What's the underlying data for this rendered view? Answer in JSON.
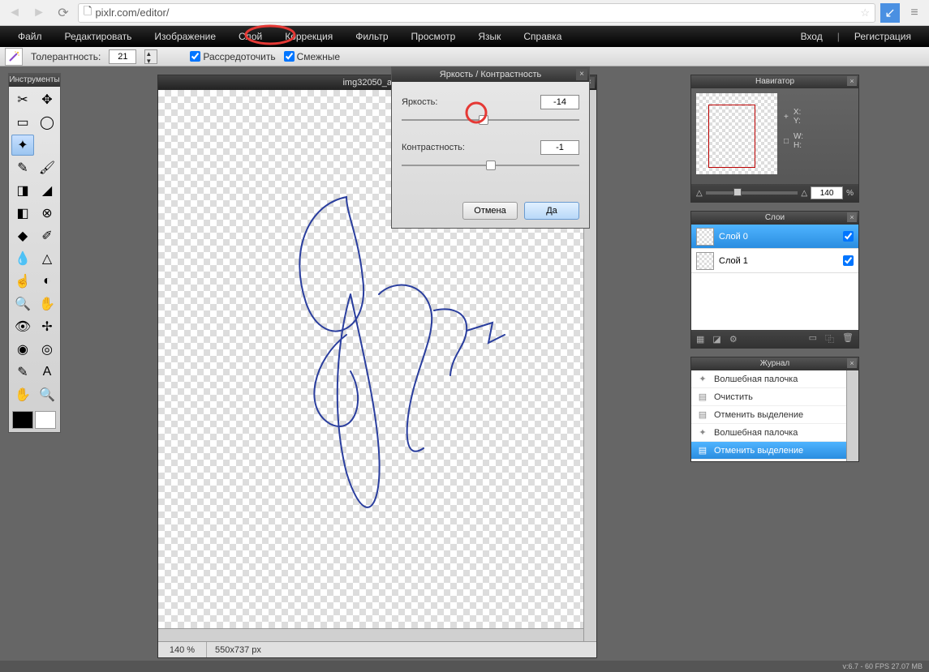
{
  "browser": {
    "url": "pixlr.com/editor/"
  },
  "menu": {
    "items": [
      "Файл",
      "Редактировать",
      "Изображение",
      "Слой",
      "Коррекция",
      "Фильтр",
      "Просмотр",
      "Язык",
      "Справка"
    ],
    "login": "Вход",
    "register": "Регистрация"
  },
  "options": {
    "tolerance_label": "Толерантность:",
    "tolerance_value": "21",
    "option1_label": "Рассредоточить",
    "option2_label": "Смежные"
  },
  "tools": {
    "title": "Инструменты"
  },
  "canvas": {
    "title": "img32050_auto...",
    "zoom": "140 %",
    "dimensions": "550x737 px"
  },
  "dialog": {
    "title": "Яркость / Контрастность",
    "brightness_label": "Яркость:",
    "brightness_value": "-14",
    "contrast_label": "Контрастность:",
    "contrast_value": "-1",
    "cancel": "Отмена",
    "ok": "Да"
  },
  "navigator": {
    "title": "Навигатор",
    "x_label": "X:",
    "y_label": "Y:",
    "w_label": "W:",
    "h_label": "H:",
    "zoom": "140",
    "zoom_pct": "%"
  },
  "layers": {
    "title": "Слои",
    "items": [
      {
        "name": "Слой 0",
        "selected": true
      },
      {
        "name": "Слой 1",
        "selected": false
      }
    ]
  },
  "history": {
    "title": "Журнал",
    "items": [
      {
        "label": "Волшебная палочка",
        "icon": "✦"
      },
      {
        "label": "Очистить",
        "icon": "▤"
      },
      {
        "label": "Отменить выделение",
        "icon": "▤"
      },
      {
        "label": "Волшебная палочка",
        "icon": "✦"
      },
      {
        "label": "Отменить выделение",
        "icon": "▤",
        "selected": true
      }
    ]
  },
  "status": {
    "text": "v:6.7 - 60 FPS 27.07 MB"
  }
}
